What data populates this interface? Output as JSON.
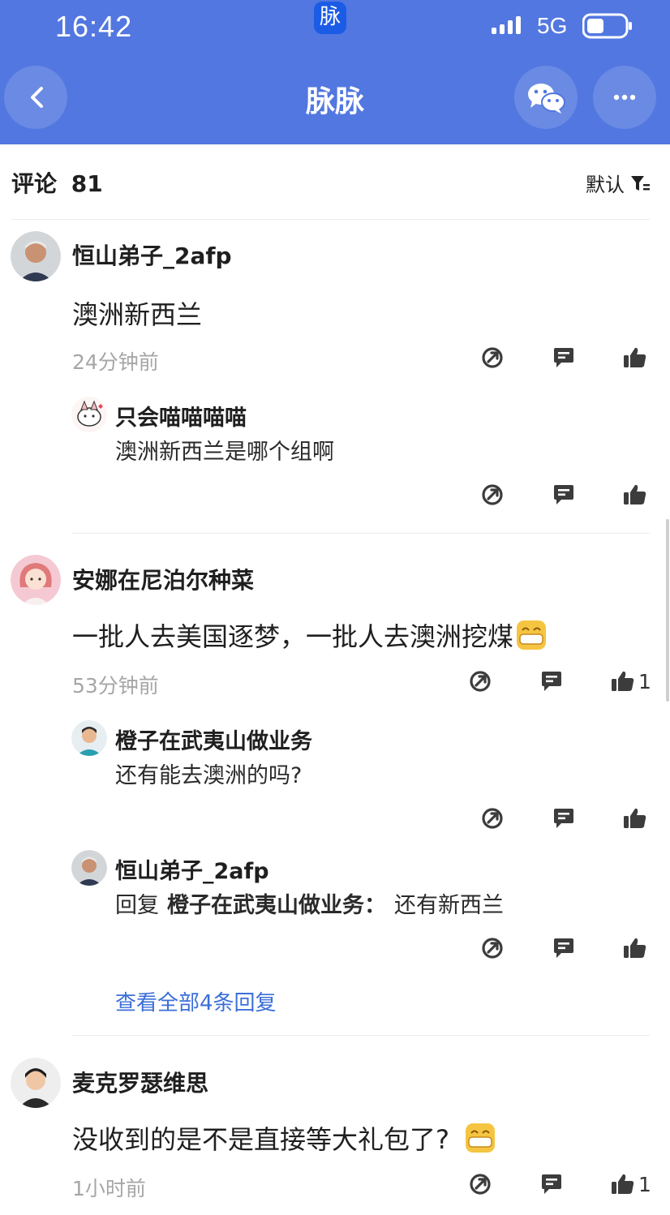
{
  "status_bar": {
    "time": "16:42",
    "app_badge": "脉",
    "network": "5G"
  },
  "header": {
    "title": "脉脉",
    "back_icon": "chevron-left-icon",
    "wechat_icon": "wechat-icon",
    "more_icon": "more-icon"
  },
  "comments_header": {
    "label": "评论",
    "count": "81",
    "sort_label": "默认",
    "sort_icon": "filter-icon"
  },
  "comments": [
    {
      "author": "恒山弟子_2afp",
      "text": "澳洲新西兰",
      "time": "24分钟前",
      "likes": "",
      "replies": [
        {
          "author": "只会喵喵喵喵",
          "text": "澳洲新西兰是哪个组啊"
        }
      ]
    },
    {
      "author": "安娜在尼泊尔种菜",
      "text": "一批人去美国逐梦，一批人去澳洲挖煤",
      "time": "53分钟前",
      "likes": "1",
      "replies": [
        {
          "author": "橙子在武夷山做业务",
          "text": "还有能去澳洲的吗?"
        },
        {
          "author": "恒山弟子_2afp",
          "reply_prefix": "回复",
          "reply_to": "橙子在武夷山做业务：",
          "text": "还有新西兰"
        }
      ],
      "view_all": "查看全部4条回复"
    },
    {
      "author": "麦克罗瑟维思",
      "text": "没收到的是不是直接等大礼包了?",
      "time": "1小时前",
      "likes": "1",
      "replies": []
    }
  ],
  "colors": {
    "header_bg": "#5277e0",
    "link": "#3b6fd8",
    "timestamp": "#a6a6a6",
    "icon": "#3c3c3c"
  }
}
